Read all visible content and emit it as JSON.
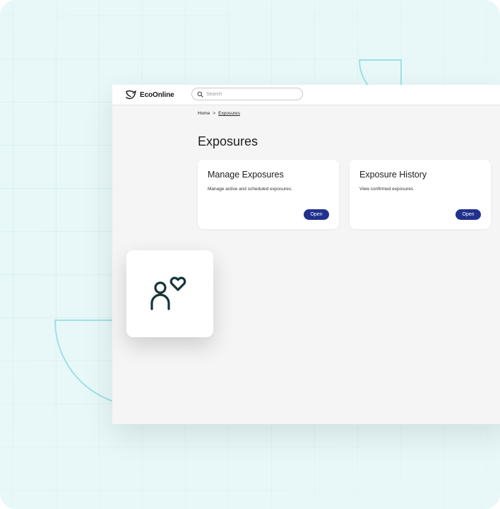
{
  "app": {
    "brand": "EcoOnline"
  },
  "search": {
    "placeholder": "Search",
    "value": ""
  },
  "breadcrumb": {
    "home": "Home",
    "separator": ">",
    "current": "Exposures"
  },
  "page": {
    "title": "Exposures"
  },
  "cards": [
    {
      "title": "Manage Exposures",
      "description": "Manage active and scheduled exposures.",
      "button": "Open"
    },
    {
      "title": "Exposure History",
      "description": "View confirmed exposures",
      "button": "Open"
    }
  ],
  "feature_tile": {
    "icon": "person-heart-icon"
  },
  "colors": {
    "background": "#e8f8f8",
    "accent_line": "#9fe0e3",
    "primary_button": "#21318e",
    "icon_stroke": "#173537"
  }
}
